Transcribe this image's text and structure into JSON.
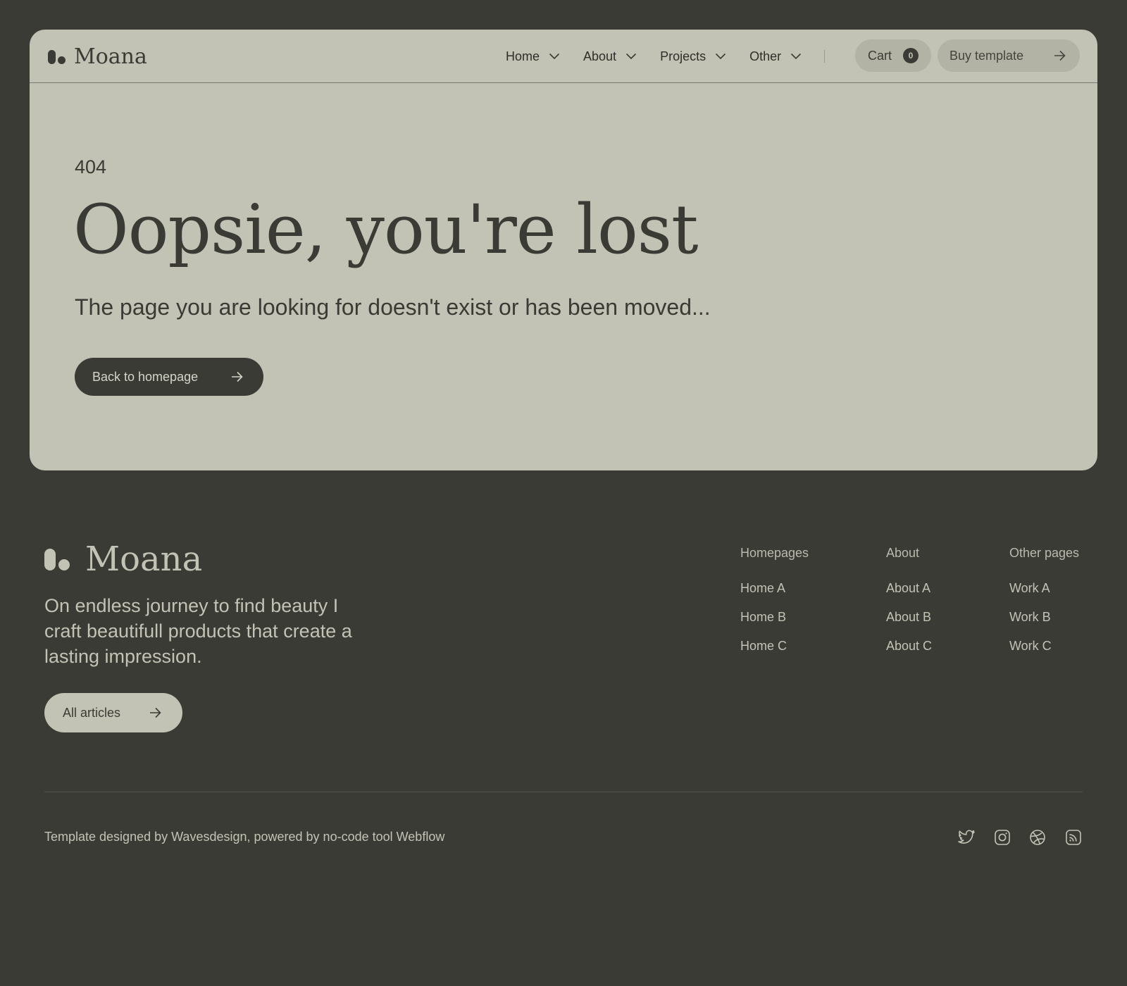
{
  "header": {
    "brand": "Moana",
    "nav": [
      {
        "label": "Home",
        "icon": "chevron-down-icon"
      },
      {
        "label": "About",
        "icon": "chevron-down-icon"
      },
      {
        "label": "Projects",
        "icon": "chevron-down-icon"
      },
      {
        "label": "Other",
        "icon": "chevron-down-icon"
      }
    ],
    "cart_label": "Cart",
    "cart_count": "0",
    "buy_label": "Buy template"
  },
  "hero": {
    "code": "404",
    "title": "Oopsie, you're lost",
    "subtitle": "The page you are looking for doesn't exist or has been moved...",
    "button_label": "Back to homepage"
  },
  "footer": {
    "brand": "Moana",
    "tagline": "On endless journey to find beauty I craft beautifull products that create a lasting impression.",
    "button_label": "All articles",
    "columns": [
      {
        "title": "Homepages",
        "links": [
          "Home A",
          "Home B",
          "Home C"
        ]
      },
      {
        "title": "About",
        "links": [
          "About A",
          "About B",
          "About C"
        ]
      },
      {
        "title": "Other pages",
        "links": [
          "Work A",
          "Work B",
          "Work C"
        ]
      }
    ],
    "credit": "Template designed by Wavesdesign, powered by no-code tool Webflow",
    "social": [
      "twitter-icon",
      "instagram-icon",
      "dribbble-icon",
      "rss-icon"
    ]
  },
  "colors": {
    "background": "#3b3b35",
    "card": "#c2c2b5",
    "pill": "#b2b2a5"
  }
}
